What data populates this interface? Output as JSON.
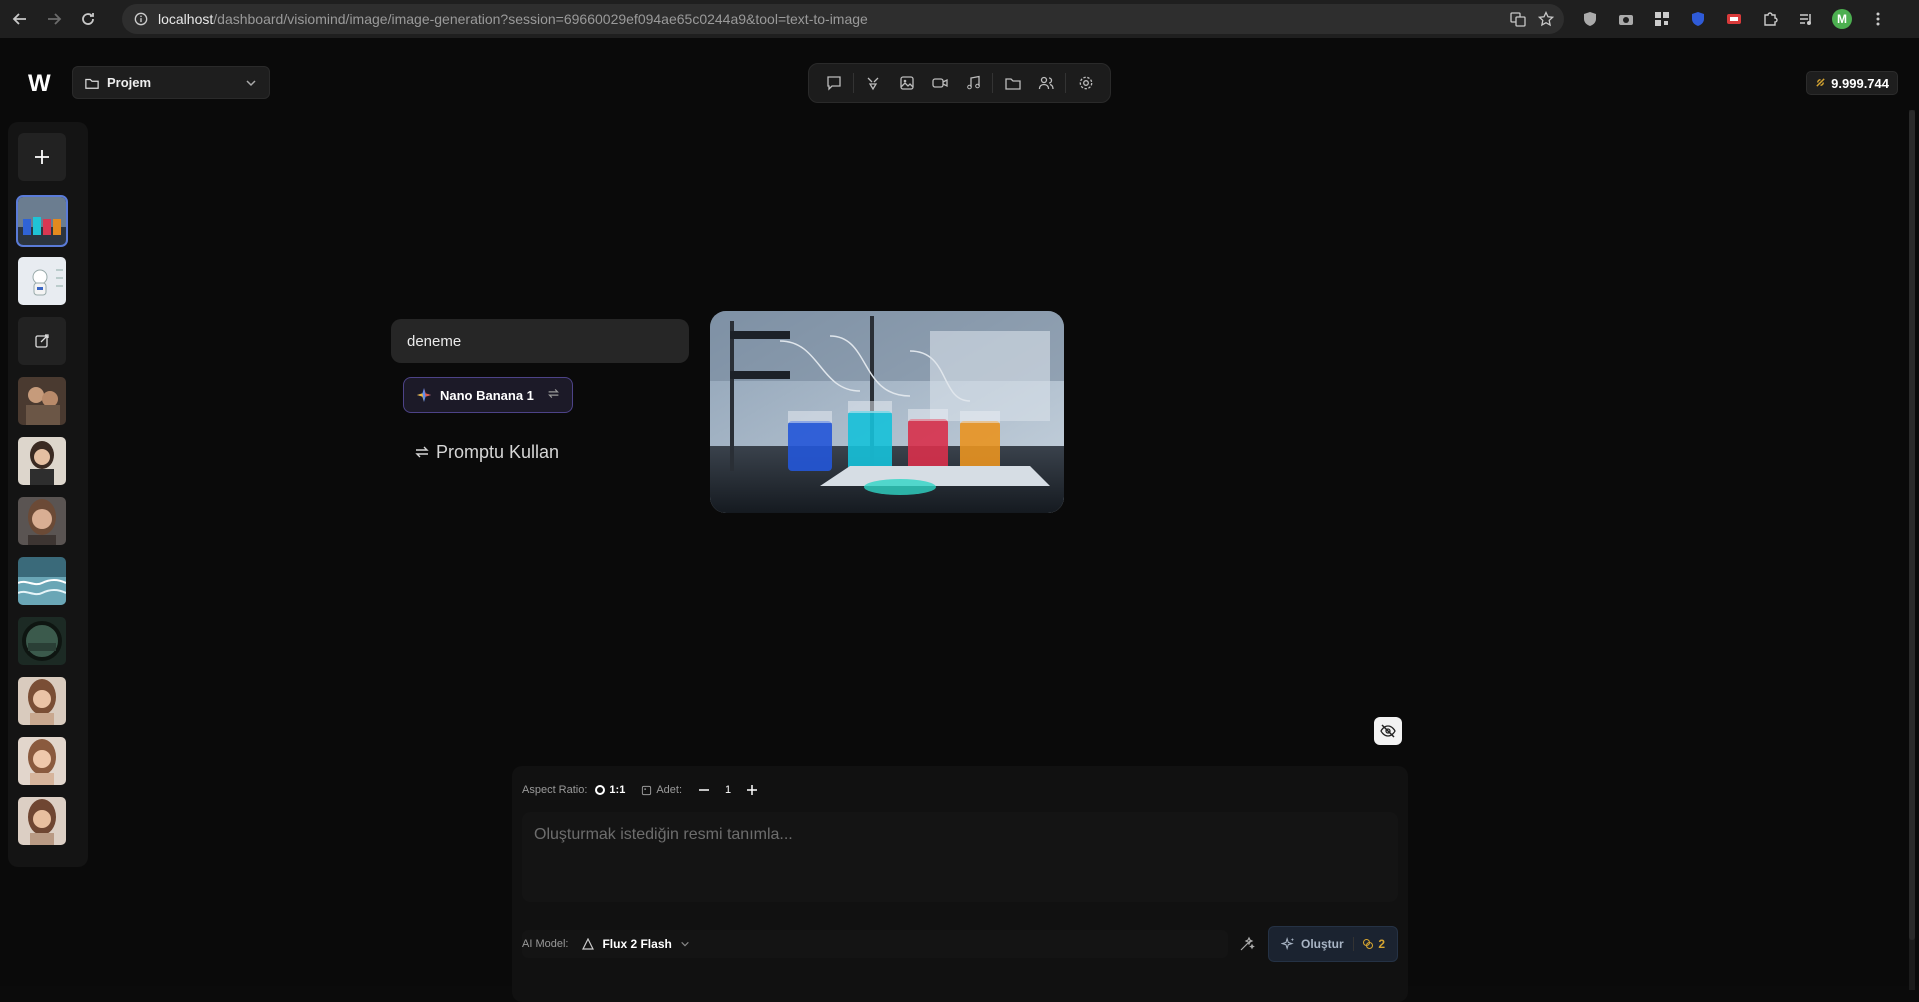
{
  "browser": {
    "url_host": "localhost",
    "url_path": "/dashboard/visiomind/image/image-generation?session=69660029ef094ae65c0244a9&tool=text-to-image",
    "profile_initial": "M"
  },
  "header": {
    "logo": "W",
    "project_label": "Projem",
    "credits": "9.999.744",
    "tools": [
      "chat-icon",
      "image-edit-icon",
      "image-icon",
      "video-icon",
      "music-icon",
      "folder-icon",
      "users-icon",
      "settings-icon"
    ]
  },
  "content": {
    "prompt_text": "deneme",
    "model_chip": "Nano Banana 1",
    "use_prompt_label": "Promptu Kullan"
  },
  "panel": {
    "aspect_label": "Aspect Ratio:",
    "aspect_value": "1:1",
    "count_label": "Adet:",
    "count_value": "1",
    "textarea_placeholder": "Oluşturmak istediğin resmi tanımla...",
    "model_label": "AI Model:",
    "model_value": "Flux 2 Flash",
    "create_label": "Oluştur",
    "create_cost": "2"
  },
  "colors": {
    "accent_purple": "#4d4388",
    "coin_gold": "#d6a531",
    "selected_blue": "#5a7bd8"
  }
}
